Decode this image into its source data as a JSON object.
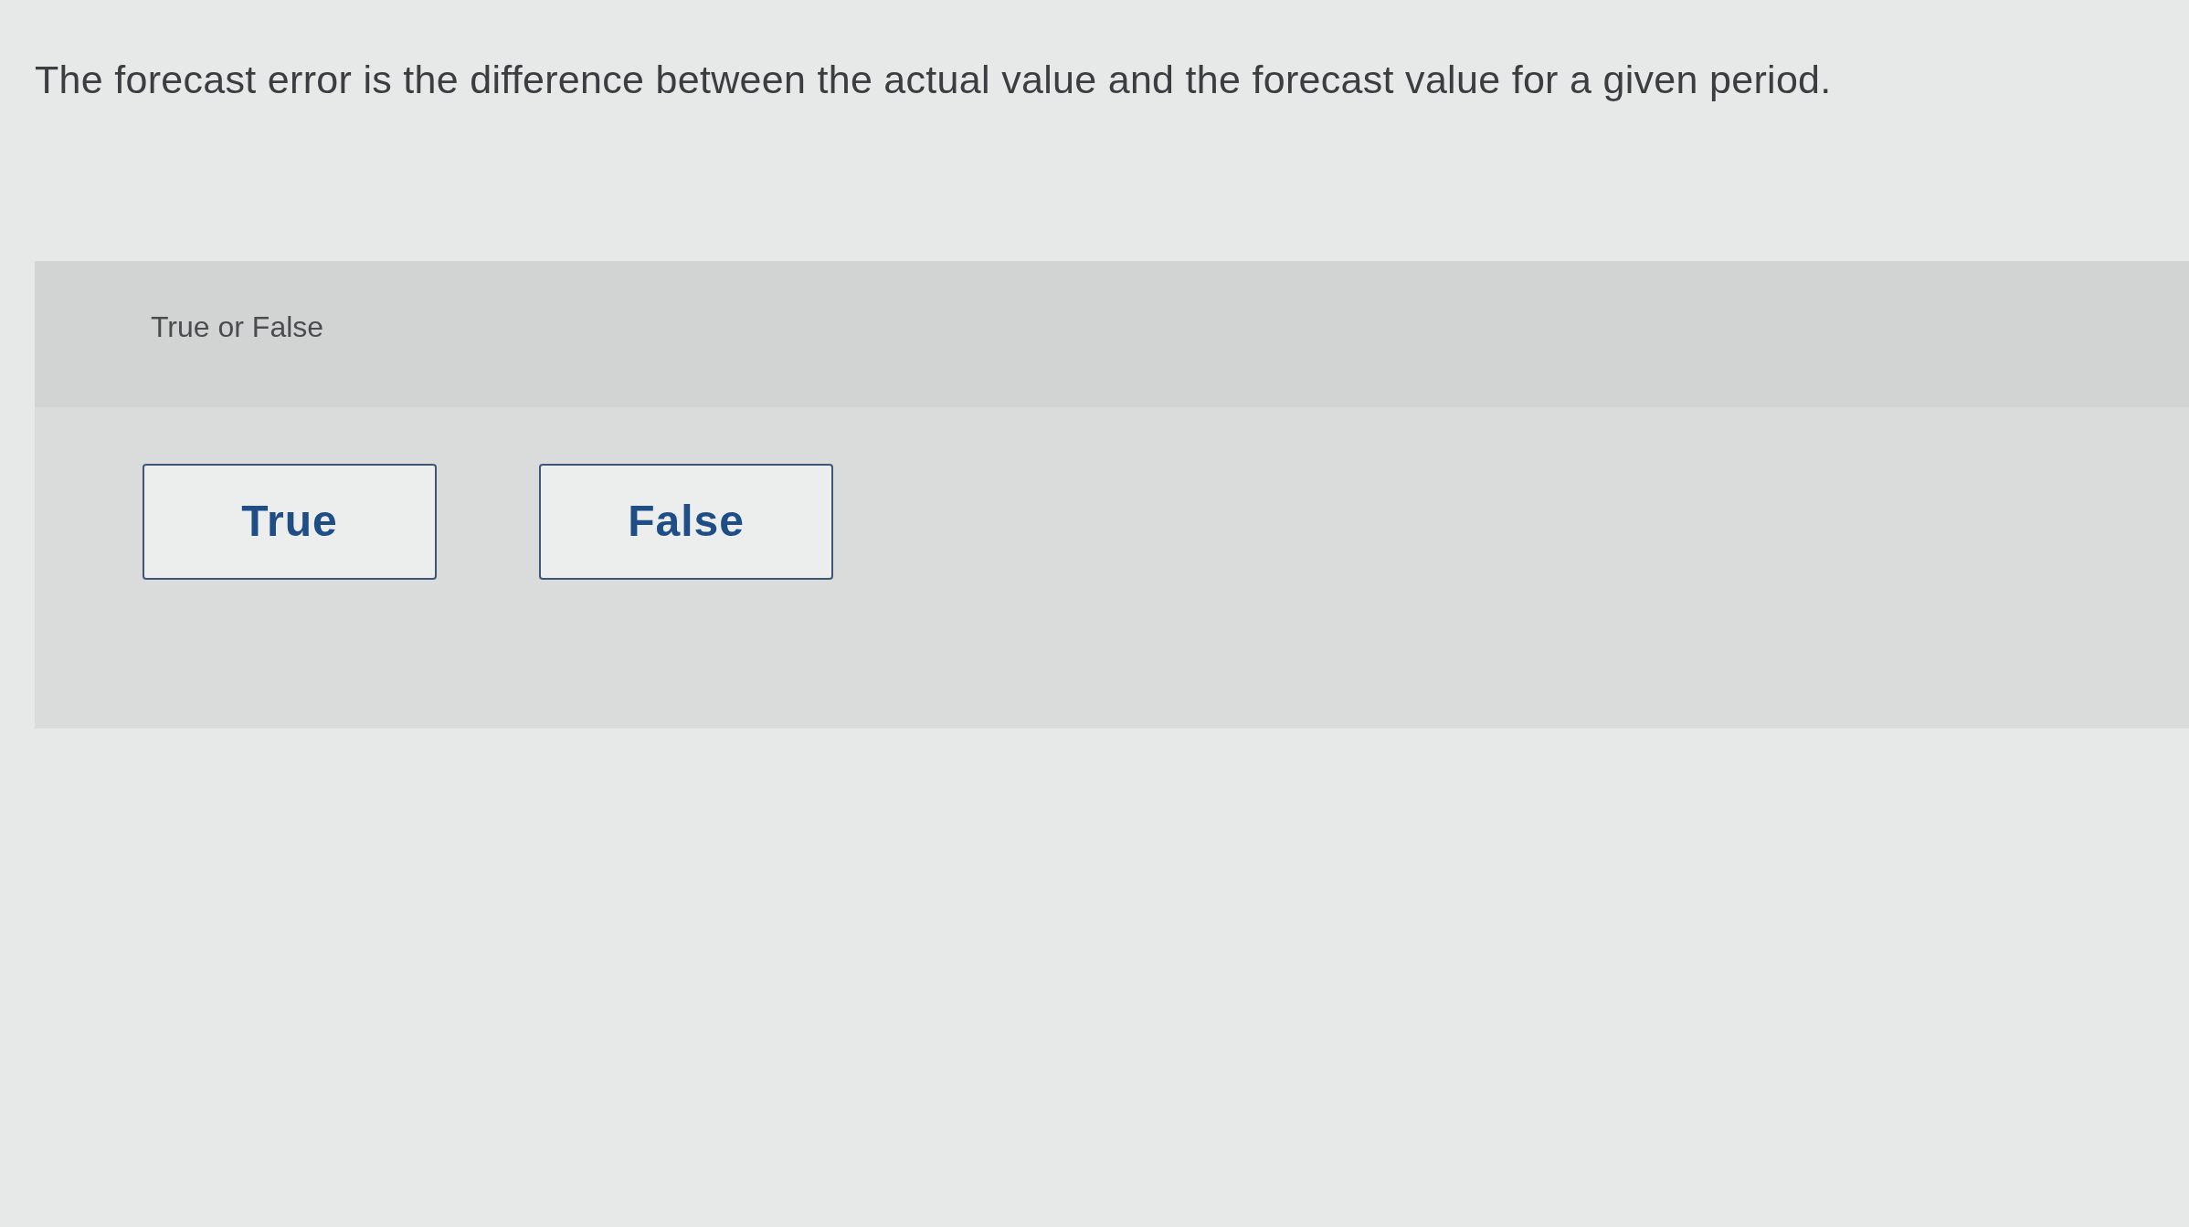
{
  "question": {
    "text": "The forecast error is the difference between the actual value and the forecast value for a given period."
  },
  "answer_panel": {
    "prompt": "True or False",
    "options": [
      {
        "label": "True",
        "selected": false
      },
      {
        "label": "False",
        "selected": false
      }
    ]
  }
}
